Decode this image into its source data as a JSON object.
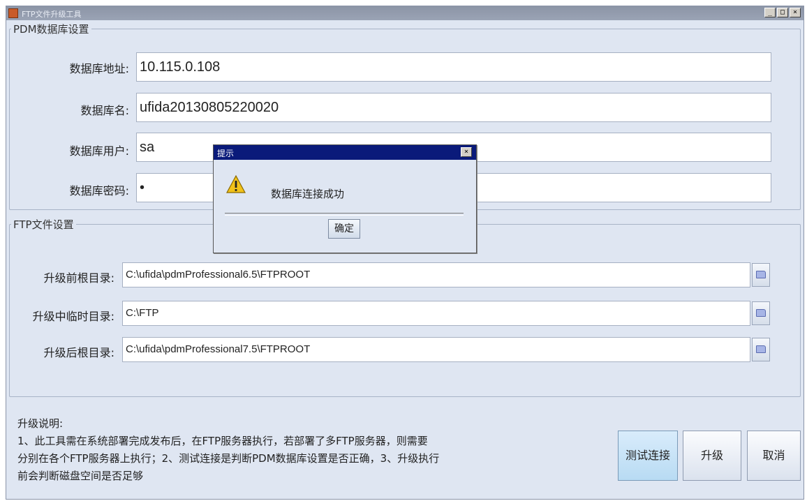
{
  "window": {
    "title": "FTP文件升级工具",
    "buttons": {
      "minimize": "_",
      "maximize": "□",
      "close": "×"
    }
  },
  "db_settings": {
    "legend": "PDM数据库设置",
    "address_label": "数据库地址:",
    "address_value": "10.115.0.108",
    "name_label": "数据库名:",
    "name_value": "ufida20130805220020",
    "user_label": "数据库用户:",
    "user_value": "sa",
    "password_label": "数据库密码:",
    "password_value": "•"
  },
  "ftp_settings": {
    "legend": "FTP文件设置",
    "before_label": "升级前根目录:",
    "before_value": "C:\\ufida\\pdmProfessional6.5\\FTPROOT",
    "temp_label": "升级中临时目录:",
    "temp_value": "C:\\FTP",
    "after_label": "升级后根目录:",
    "after_value": "C:\\ufida\\pdmProfessional7.5\\FTPROOT"
  },
  "description": {
    "title": "升级说明:",
    "line1": "1、此工具需在系统部署完成发布后，在FTP服务器执行，若部署了多FTP服务器，则需要",
    "line2": "分别在各个FTP服务器上执行；2、测试连接是判断PDM数据库设置是否正确，3、升级执行",
    "line3": "前会判断磁盘空间是否足够"
  },
  "actions": {
    "test": "测试连接",
    "upgrade": "升级",
    "cancel": "取消"
  },
  "dialog": {
    "title": "提示",
    "close": "×",
    "message": "数据库连接成功",
    "ok": "确定"
  },
  "icons": {
    "app": "app-icon",
    "folder": "folder-icon",
    "warning": "warning-icon"
  },
  "colors": {
    "dialog_title": "#0a1a7a",
    "focus_button": "#b8dbf3",
    "background": "#dfe6f2"
  }
}
